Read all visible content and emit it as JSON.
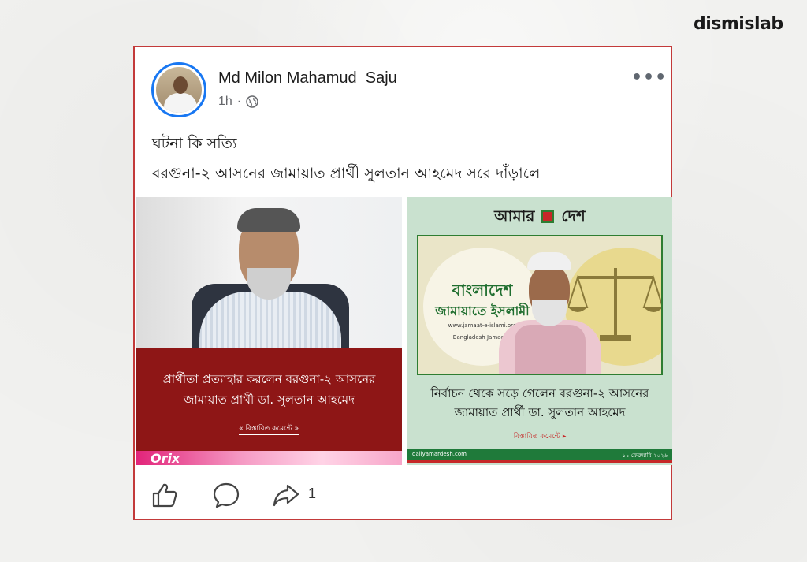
{
  "brand": "dismislab",
  "post": {
    "author": "Md Milon Mahamud  Saju",
    "time": "1h",
    "dot": "·",
    "more": "•••",
    "text_line1": "ঘটনা কি সত্যি",
    "text_line2": "বরগুনা-২ আসনের জামায়াত প্রার্থী সুলতান আহমেদ সরে দাঁড়ালে"
  },
  "left_image": {
    "headline_line1": "প্রার্থীতা প্রত্যাহার করলেন বরগুনা-২ আসনের",
    "headline_line2": "জামায়াত প্রার্থী ডা. সুলতান আহমেদ",
    "more": "« বিস্তারিত কমেন্টে »",
    "ad_text": "Orix"
  },
  "right_image": {
    "masthead_left": "আমার",
    "masthead_right": "দেশ",
    "logo_line1": "বাংলাদেশ",
    "logo_line2": "জামায়াতে ইসলামী",
    "logo_url": "www.jamaat-e-islami.org",
    "logo_en": "Bangladesh Jamaat-e",
    "headline_line1": "নির্বাচন থেকে সড়ে গেলেন বরগুনা-২ আসনের",
    "headline_line2": "জামায়াত প্রার্থী ডা. সুলতান আহমেদ",
    "more": "বিস্তারিত কমেন্টে ▸",
    "footer_site": "dailyamardesh.com",
    "footer_date": "১১ ফেব্রুয়ারি ২০২৬"
  },
  "actions": {
    "like_icon": "thumbs-up-icon",
    "comment_icon": "comment-bubble-icon",
    "share_icon": "share-arrow-icon",
    "share_count": "1"
  },
  "colors": {
    "frame": "#c33a3a",
    "avatar_ring": "#1877f2",
    "left_banner": "#8e1616",
    "right_bg": "#c9e1cf",
    "right_accent": "#1f7a3a"
  }
}
